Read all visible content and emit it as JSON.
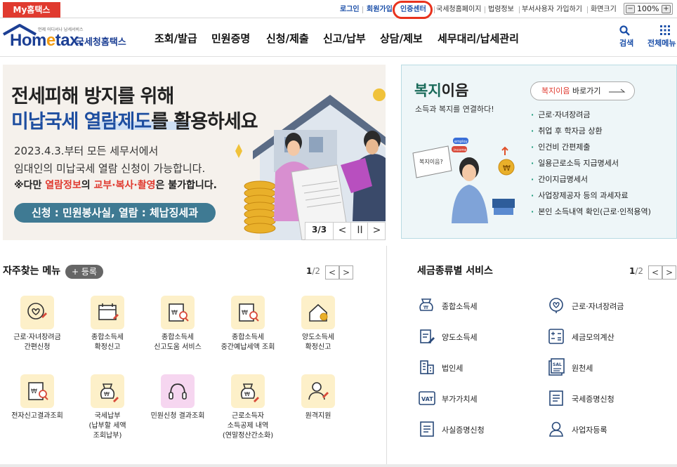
{
  "my_tab": "My홈택스",
  "util_nav": {
    "login": "로그인",
    "signup": "회원가입",
    "cert_center": "인증센터",
    "nts_home": "국세청홈페이지",
    "law_info": "법령정보",
    "dept_signup": "부서사용자 가입하기",
    "screen_size": "화면크기",
    "zoom": "100%",
    "zoom_minus": "−",
    "zoom_plus": "+"
  },
  "logo": {
    "sub": "언제 어디서나 납세서비스",
    "main_1": "Hom",
    "main_e": "e",
    "main_2": "tax.",
    "name": "국세청홈택스"
  },
  "gnb": [
    "조회/발급",
    "민원증명",
    "신청/제출",
    "신고/납부",
    "상담/제보",
    "세무대리/납세관리"
  ],
  "header_actions": {
    "search": "검색",
    "all_menu": "전체메뉴"
  },
  "banner": {
    "title1": "전세피해 방지를 위해",
    "title2_blue": "미납국세 열람제도",
    "title2_dark": "를 활용하세요",
    "line1": "2023.4.3.부터 모든 세무서에서",
    "line2": "임대인의 미납국세 열람 신청이 가능합니다.",
    "note_a": "※다만 ",
    "note_b": "열람정보",
    "note_c": "의 ",
    "note_d": "교부·복사·촬영",
    "note_e": "은 불가합니다.",
    "pill": "신청 : 민원봉사실, 열람 : 체납징세과",
    "counter": "3/3",
    "prev": "<",
    "pause": "II",
    "next": ">"
  },
  "welfare": {
    "title_a": "복지",
    "title_b": "이음",
    "subtitle": "소득과 복지를 연결하다!",
    "btn_a": "복지이음",
    "btn_b": " 바로가기",
    "items": [
      "근로·자녀장려금",
      "취업 후 학자금 상환",
      "인건비 간편제출",
      "일용근로소득 지급명세서",
      "간이지급명세서",
      "사업장제공자 등의 과세자료",
      "본인 소득내역 확인(근로·인적용역)"
    ],
    "img_board": "복지이음?",
    "img_tag1": "employ",
    "img_tag2": "income",
    "img_tag3": "welfare"
  },
  "frequent": {
    "title": "자주찾는 메뉴",
    "register": "+ 등록",
    "page_cur": "1",
    "page_total": "/2",
    "row1": [
      {
        "l1": "근로·자녀장려금",
        "l2": "간편신청"
      },
      {
        "l1": "종합소득세",
        "l2": "확정신고"
      },
      {
        "l1": "종합소득세",
        "l2": "신고도움 서비스"
      },
      {
        "l1": "종합소득세",
        "l2": "중간예납세액 조회"
      },
      {
        "l1": "양도소득세",
        "l2": "확정신고"
      }
    ],
    "row2": [
      {
        "l1": "전자신고결과조회",
        "l2": "",
        "l3": ""
      },
      {
        "l1": "국세납부",
        "l2": "(납부할 세액",
        "l3": "조회납부)"
      },
      {
        "l1": "민원신청 결과조회",
        "l2": "",
        "l3": ""
      },
      {
        "l1": "근로소득자",
        "l2": "소득공제 내역",
        "l3": "(연말정산간소화)"
      },
      {
        "l1": "원격지원",
        "l2": "",
        "l3": ""
      }
    ]
  },
  "tax_services": {
    "title": "세금종류별 서비스",
    "page_cur": "1",
    "page_total": "/2",
    "left": [
      "종합소득세",
      "양도소득세",
      "법인세",
      "부가가치세",
      "사실증명신청"
    ],
    "right": [
      "근로·자녀장려금",
      "세금모의계산",
      "원천세",
      "국세증명신청",
      "사업자등록"
    ],
    "vat_text": "VAT",
    "sal_text": "SAL"
  }
}
